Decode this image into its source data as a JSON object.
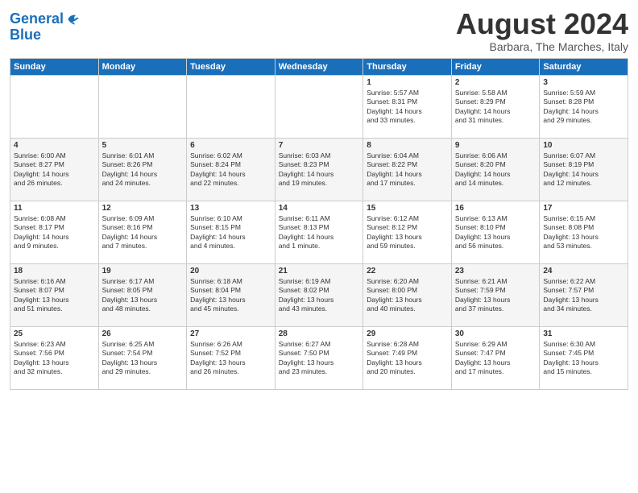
{
  "logo": {
    "line1": "General",
    "line2": "Blue"
  },
  "title": "August 2024",
  "location": "Barbara, The Marches, Italy",
  "days_header": [
    "Sunday",
    "Monday",
    "Tuesday",
    "Wednesday",
    "Thursday",
    "Friday",
    "Saturday"
  ],
  "weeks": [
    [
      {
        "day": "",
        "info": ""
      },
      {
        "day": "",
        "info": ""
      },
      {
        "day": "",
        "info": ""
      },
      {
        "day": "",
        "info": ""
      },
      {
        "day": "1",
        "info": "Sunrise: 5:57 AM\nSunset: 8:31 PM\nDaylight: 14 hours\nand 33 minutes."
      },
      {
        "day": "2",
        "info": "Sunrise: 5:58 AM\nSunset: 8:29 PM\nDaylight: 14 hours\nand 31 minutes."
      },
      {
        "day": "3",
        "info": "Sunrise: 5:59 AM\nSunset: 8:28 PM\nDaylight: 14 hours\nand 29 minutes."
      }
    ],
    [
      {
        "day": "4",
        "info": "Sunrise: 6:00 AM\nSunset: 8:27 PM\nDaylight: 14 hours\nand 26 minutes."
      },
      {
        "day": "5",
        "info": "Sunrise: 6:01 AM\nSunset: 8:26 PM\nDaylight: 14 hours\nand 24 minutes."
      },
      {
        "day": "6",
        "info": "Sunrise: 6:02 AM\nSunset: 8:24 PM\nDaylight: 14 hours\nand 22 minutes."
      },
      {
        "day": "7",
        "info": "Sunrise: 6:03 AM\nSunset: 8:23 PM\nDaylight: 14 hours\nand 19 minutes."
      },
      {
        "day": "8",
        "info": "Sunrise: 6:04 AM\nSunset: 8:22 PM\nDaylight: 14 hours\nand 17 minutes."
      },
      {
        "day": "9",
        "info": "Sunrise: 6:06 AM\nSunset: 8:20 PM\nDaylight: 14 hours\nand 14 minutes."
      },
      {
        "day": "10",
        "info": "Sunrise: 6:07 AM\nSunset: 8:19 PM\nDaylight: 14 hours\nand 12 minutes."
      }
    ],
    [
      {
        "day": "11",
        "info": "Sunrise: 6:08 AM\nSunset: 8:17 PM\nDaylight: 14 hours\nand 9 minutes."
      },
      {
        "day": "12",
        "info": "Sunrise: 6:09 AM\nSunset: 8:16 PM\nDaylight: 14 hours\nand 7 minutes."
      },
      {
        "day": "13",
        "info": "Sunrise: 6:10 AM\nSunset: 8:15 PM\nDaylight: 14 hours\nand 4 minutes."
      },
      {
        "day": "14",
        "info": "Sunrise: 6:11 AM\nSunset: 8:13 PM\nDaylight: 14 hours\nand 1 minute."
      },
      {
        "day": "15",
        "info": "Sunrise: 6:12 AM\nSunset: 8:12 PM\nDaylight: 13 hours\nand 59 minutes."
      },
      {
        "day": "16",
        "info": "Sunrise: 6:13 AM\nSunset: 8:10 PM\nDaylight: 13 hours\nand 56 minutes."
      },
      {
        "day": "17",
        "info": "Sunrise: 6:15 AM\nSunset: 8:08 PM\nDaylight: 13 hours\nand 53 minutes."
      }
    ],
    [
      {
        "day": "18",
        "info": "Sunrise: 6:16 AM\nSunset: 8:07 PM\nDaylight: 13 hours\nand 51 minutes."
      },
      {
        "day": "19",
        "info": "Sunrise: 6:17 AM\nSunset: 8:05 PM\nDaylight: 13 hours\nand 48 minutes."
      },
      {
        "day": "20",
        "info": "Sunrise: 6:18 AM\nSunset: 8:04 PM\nDaylight: 13 hours\nand 45 minutes."
      },
      {
        "day": "21",
        "info": "Sunrise: 6:19 AM\nSunset: 8:02 PM\nDaylight: 13 hours\nand 43 minutes."
      },
      {
        "day": "22",
        "info": "Sunrise: 6:20 AM\nSunset: 8:00 PM\nDaylight: 13 hours\nand 40 minutes."
      },
      {
        "day": "23",
        "info": "Sunrise: 6:21 AM\nSunset: 7:59 PM\nDaylight: 13 hours\nand 37 minutes."
      },
      {
        "day": "24",
        "info": "Sunrise: 6:22 AM\nSunset: 7:57 PM\nDaylight: 13 hours\nand 34 minutes."
      }
    ],
    [
      {
        "day": "25",
        "info": "Sunrise: 6:23 AM\nSunset: 7:56 PM\nDaylight: 13 hours\nand 32 minutes."
      },
      {
        "day": "26",
        "info": "Sunrise: 6:25 AM\nSunset: 7:54 PM\nDaylight: 13 hours\nand 29 minutes."
      },
      {
        "day": "27",
        "info": "Sunrise: 6:26 AM\nSunset: 7:52 PM\nDaylight: 13 hours\nand 26 minutes."
      },
      {
        "day": "28",
        "info": "Sunrise: 6:27 AM\nSunset: 7:50 PM\nDaylight: 13 hours\nand 23 minutes."
      },
      {
        "day": "29",
        "info": "Sunrise: 6:28 AM\nSunset: 7:49 PM\nDaylight: 13 hours\nand 20 minutes."
      },
      {
        "day": "30",
        "info": "Sunrise: 6:29 AM\nSunset: 7:47 PM\nDaylight: 13 hours\nand 17 minutes."
      },
      {
        "day": "31",
        "info": "Sunrise: 6:30 AM\nSunset: 7:45 PM\nDaylight: 13 hours\nand 15 minutes."
      }
    ]
  ]
}
